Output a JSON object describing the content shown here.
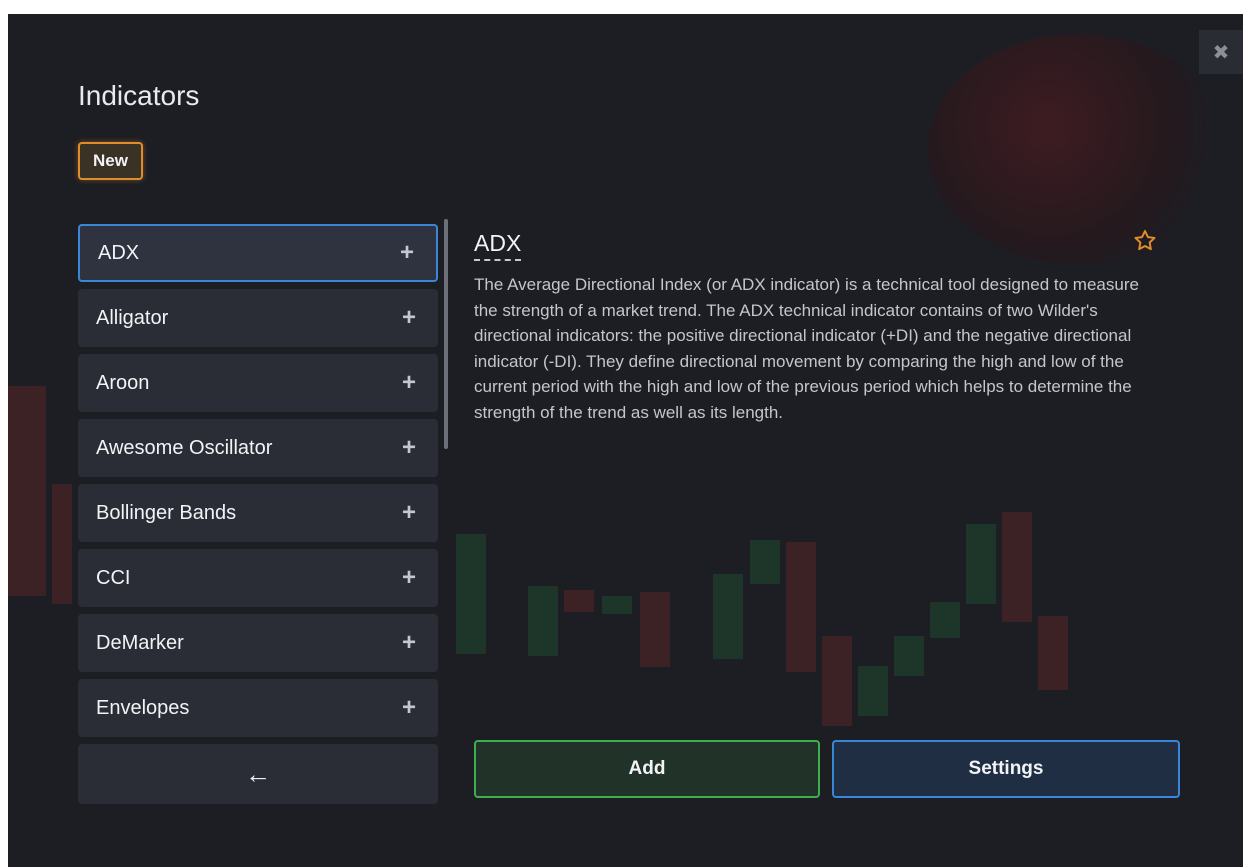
{
  "dialog": {
    "title": "Indicators",
    "badge": "New",
    "close_icon": "close-icon"
  },
  "list": {
    "items": [
      {
        "label": "ADX",
        "active": true
      },
      {
        "label": "Alligator"
      },
      {
        "label": "Aroon"
      },
      {
        "label": "Awesome Oscillator"
      },
      {
        "label": "Bollinger Bands"
      },
      {
        "label": "CCI"
      },
      {
        "label": "DeMarker"
      },
      {
        "label": "Envelopes"
      }
    ],
    "add_icon": "+",
    "back_icon": "←"
  },
  "detail": {
    "title": "ADX",
    "favorite_icon": "star-outline-icon",
    "description": "The Average Directional Index (or ADX indicator) is a technical tool designed to measure the strength of a market trend. The ADX technical indicator contains of two Wilder's directional indicators: the positive directional indicator (+DI) and the negative directional indicator (-DI). They define directional movement by comparing the high and low of the current period with the high and low of the previous period which helps to determine the strength of the trend as well as its length."
  },
  "actions": {
    "add_label": "Add",
    "settings_label": "Settings"
  },
  "colors": {
    "accent_orange": "#e08d2b",
    "accent_blue": "#3a86d8",
    "accent_green": "#3fae4f",
    "background": "#1c1e24"
  }
}
